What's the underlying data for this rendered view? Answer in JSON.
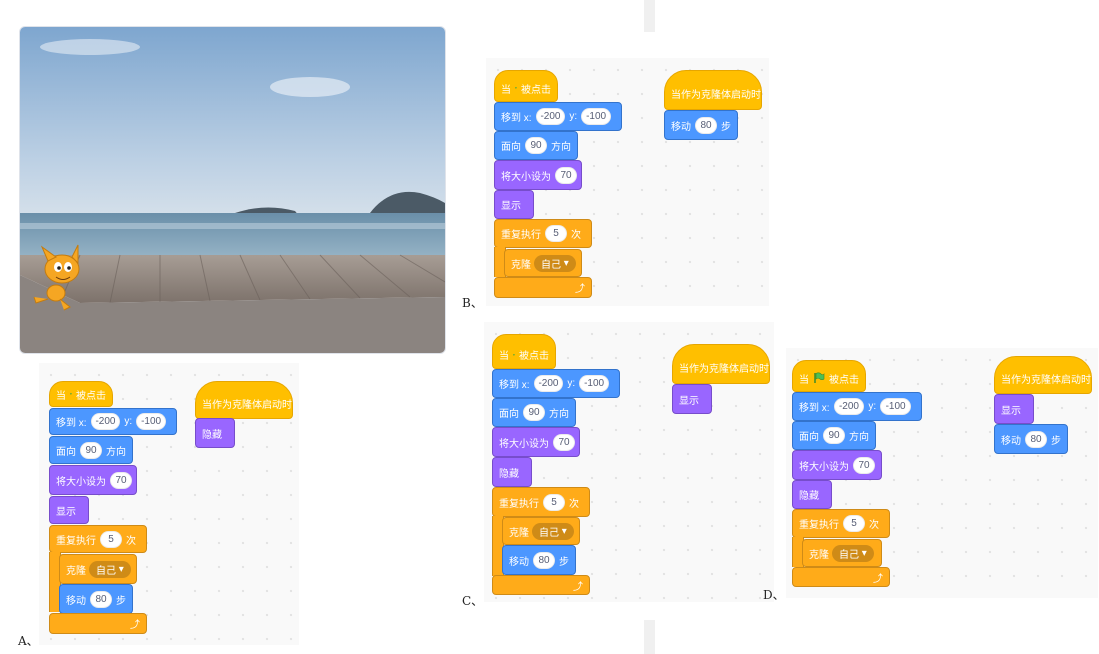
{
  "colors": {
    "events": "#ffbf00",
    "motion": "#4c97ff",
    "looks": "#9966ff",
    "control": "#ffab19"
  },
  "icons": {
    "flag": "green-flag-icon",
    "loop": "loop-arrow-icon",
    "dropdown": "dropdown-arrow-icon"
  },
  "stage": {
    "sprite": "scratch-cat",
    "backdrop": "boardwalk-sea"
  },
  "labels": {
    "A": "A、",
    "B": "B、",
    "C": "C、",
    "D": "D、"
  },
  "blocks": {
    "when": "当",
    "clicked": "被点击",
    "goto_prefix": "移到 x:",
    "goto_y": "y:",
    "x_val": "-200",
    "y_val": "-100",
    "point_dir": "面向",
    "dir_val": "90",
    "dir_suffix": "方向",
    "set_size": "将大小设为",
    "size_val": "70",
    "show": "显示",
    "hide": "隐藏",
    "repeat": "重复执行",
    "repeat_val": "5",
    "times": "次",
    "clone": "克隆",
    "clone_target": "自己",
    "dropdown_arrow": "▾",
    "move": "移动",
    "move_val": "80",
    "steps": "步",
    "clone_start": "当作为克隆体启动时",
    "loop_arrow": "⤴"
  }
}
